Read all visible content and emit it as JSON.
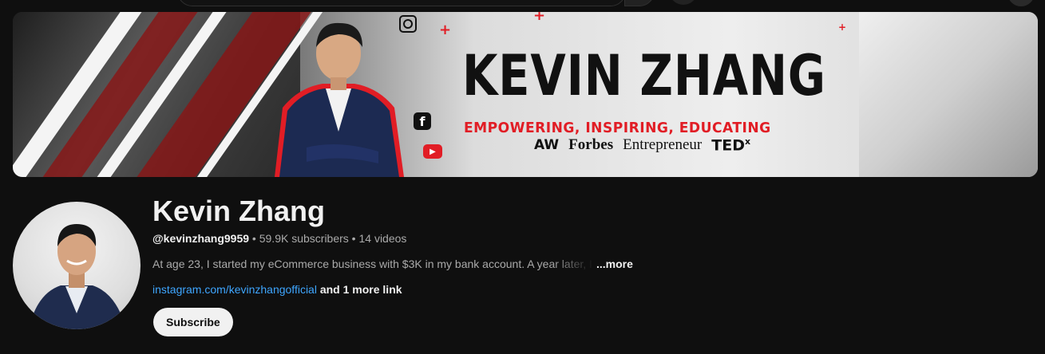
{
  "banner": {
    "title": "KEVIN ZHANG",
    "tagline": "EMPOWERING, INSPIRING, EDUCATING",
    "logos": [
      "AW",
      "Forbes",
      "Entrepreneur",
      "TED",
      "x"
    ]
  },
  "channel": {
    "name": "Kevin Zhang",
    "handle": "@kevinzhang9959",
    "subscribers": "59.9K subscribers",
    "videos": "14 videos",
    "separator": " • ",
    "description": "At age 23, I started my eCommerce business with $3K in my bank account. A year later, I",
    "more_label": "...more",
    "link_text": "instagram.com/kevinzhangofficial",
    "more_links": " and 1 more link",
    "subscribe_label": "Subscribe"
  },
  "colors": {
    "accent_red": "#e11d25",
    "link_blue": "#3ea6ff",
    "background": "#0f0f0f"
  }
}
